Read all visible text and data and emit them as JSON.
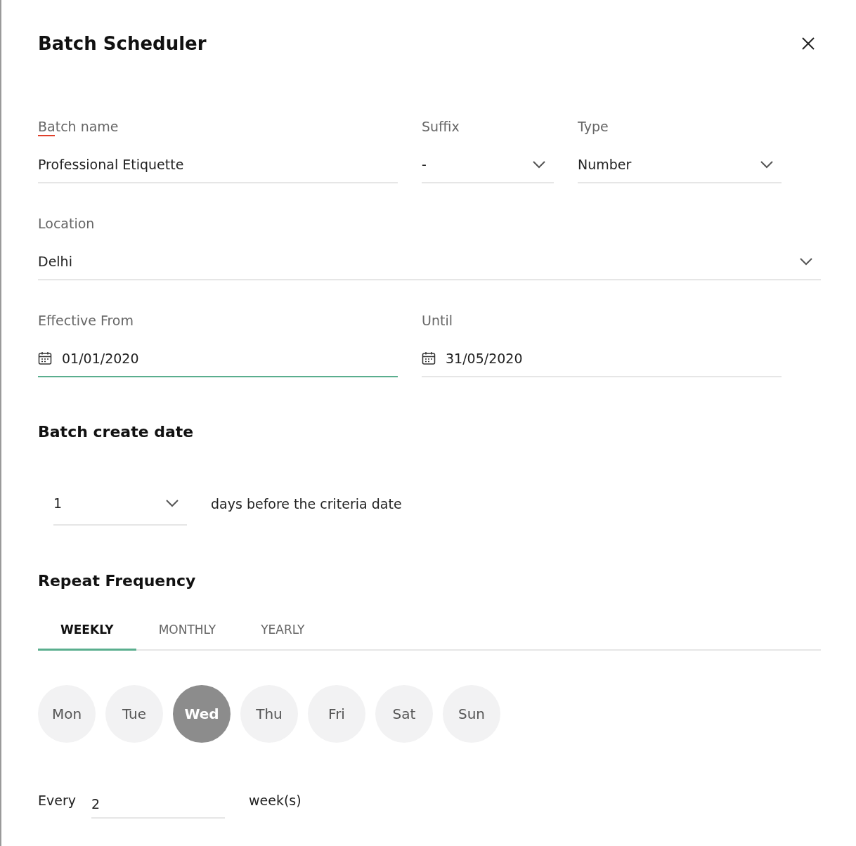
{
  "dialog": {
    "title": "Batch Scheduler"
  },
  "rows": [
    [
      {
        "label": "Batch name",
        "value": "Professional Etiquette",
        "kind": "text",
        "required": true,
        "focused": false
      },
      {
        "label": "Suffix",
        "value": "-",
        "kind": "select",
        "required": false,
        "focused": false
      },
      {
        "label": "Type",
        "value": "Number",
        "kind": "select",
        "required": false,
        "focused": false
      }
    ],
    [
      {
        "label": "Location",
        "value": "Delhi",
        "kind": "select",
        "required": false,
        "focused": false
      }
    ],
    [
      {
        "label": "Effective From",
        "value": "01/01/2020",
        "kind": "date",
        "required": false,
        "focused": true
      },
      {
        "label": "Until",
        "value": "31/05/2020",
        "kind": "date",
        "required": false,
        "focused": false
      }
    ]
  ],
  "batch_create": {
    "title": "Batch create date",
    "value": "1",
    "text": "days before the criteria date"
  },
  "repeat": {
    "title": "Repeat Frequency",
    "tabs": [
      {
        "label": "WEEKLY",
        "selected": true
      },
      {
        "label": "MONTHLY",
        "selected": false
      },
      {
        "label": "YEARLY",
        "selected": false
      }
    ],
    "days": [
      {
        "label": "Mon",
        "selected": false
      },
      {
        "label": "Tue",
        "selected": false
      },
      {
        "label": "Wed",
        "selected": true
      },
      {
        "label": "Thu",
        "selected": false
      },
      {
        "label": "Fri",
        "selected": false
      },
      {
        "label": "Sat",
        "selected": false
      },
      {
        "label": "Sun",
        "selected": false
      }
    ],
    "every": {
      "label": "Every",
      "value": "2",
      "unit": "week(s)"
    }
  }
}
